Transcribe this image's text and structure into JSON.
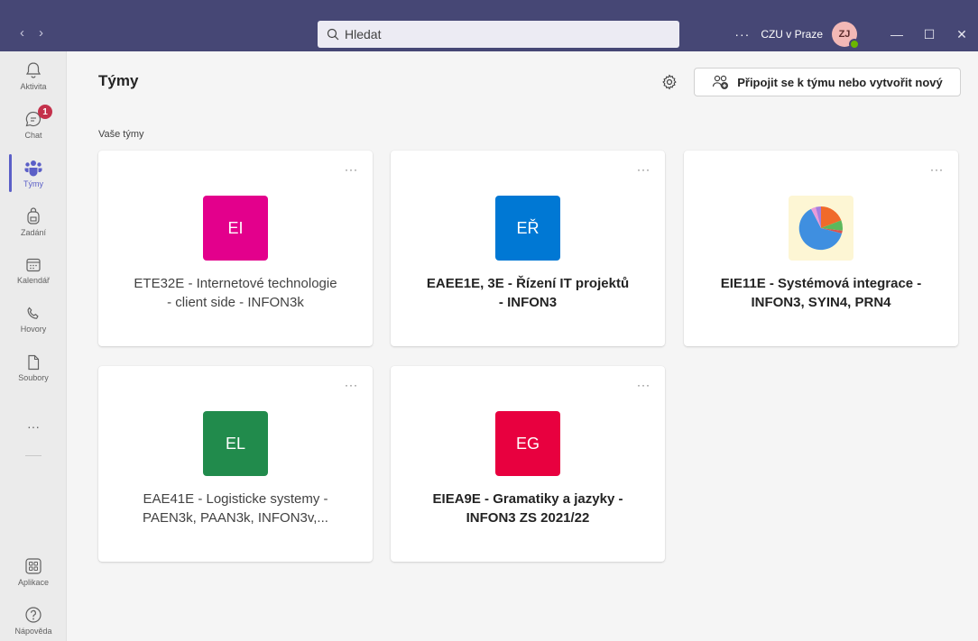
{
  "titlebar": {
    "search_placeholder": "Hledat",
    "more_label": "···",
    "org_name": "CZU v Praze",
    "user_initials": "ZJ",
    "minimize_label": "—",
    "maximize_label": "☐",
    "close_label": "✕"
  },
  "rail": {
    "items": [
      {
        "label": "Aktivita",
        "icon": "bell-icon"
      },
      {
        "label": "Chat",
        "icon": "chat-icon",
        "badge": "1"
      },
      {
        "label": "Týmy",
        "icon": "teams-icon"
      },
      {
        "label": "Zadání",
        "icon": "backpack-icon"
      },
      {
        "label": "Kalendář",
        "icon": "calendar-icon"
      },
      {
        "label": "Hovory",
        "icon": "phone-icon"
      },
      {
        "label": "Soubory",
        "icon": "file-icon"
      },
      {
        "label": "Aplikace",
        "icon": "apps-icon"
      },
      {
        "label": "Nápověda",
        "icon": "help-icon"
      }
    ],
    "more_label": "···"
  },
  "main": {
    "title": "Týmy",
    "join_button": "Připojit se k týmu nebo vytvořit nový",
    "section_label": "Vaše týmy",
    "card_more": "···",
    "teams": [
      {
        "initials": "EI",
        "color": "#e3008c",
        "name_line1": "ETE32E - Internetové technologie",
        "name_line2": "- client side - INFON3k",
        "bold": false
      },
      {
        "initials": "EŘ",
        "color": "#0078d4",
        "name_line1": "EAEE1E, 3E - Řízení IT projektů",
        "name_line2": "- INFON3",
        "bold": true
      },
      {
        "initials": "",
        "color": "#fdf6d4",
        "name_line1": "EIE11E - Systémová integrace -",
        "name_line2": "INFON3, SYIN4, PRN4",
        "bold": true,
        "pie_icon": true
      },
      {
        "initials": "EL",
        "color": "#218b4c",
        "name_line1": "EAE41E - Logisticke systemy -",
        "name_line2": "PAEN3k, PAAN3k, INFON3v,...",
        "bold": false
      },
      {
        "initials": "EG",
        "color": "#e8003f",
        "name_line1": "EIEA9E - Gramatiky a jazyky -",
        "name_line2": "INFON3 ZS 2021/22",
        "bold": true
      }
    ]
  },
  "colors": {
    "titlebar": "#464775",
    "accent": "#5b5fc7",
    "badge": "#c4314b"
  }
}
